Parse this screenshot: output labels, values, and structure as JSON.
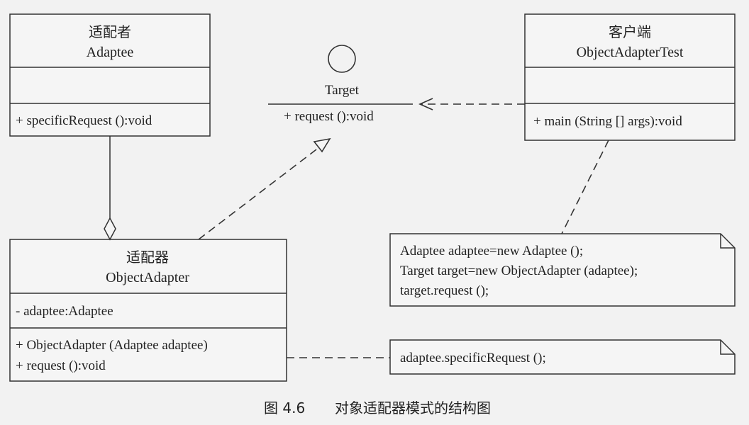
{
  "adaptee": {
    "stereotype": "适配者",
    "name": "Adaptee",
    "operation": "+ specificRequest ():void"
  },
  "target": {
    "name": "Target",
    "operation": "+ request ():void"
  },
  "client": {
    "stereotype": "客户端",
    "name": "ObjectAdapterTest",
    "operation": "+ main (String [] args):void"
  },
  "adapter": {
    "stereotype": "适配器",
    "name": "ObjectAdapter",
    "attribute": "- adaptee:Adaptee",
    "operations": [
      "+ ObjectAdapter (Adaptee adaptee)",
      "+ request ():void"
    ]
  },
  "note_client": {
    "lines": [
      "Adaptee adaptee=new Adaptee ();",
      "Target target=new ObjectAdapter (adaptee);",
      "target.request ();"
    ]
  },
  "note_adapter": {
    "text": "adaptee.specificRequest ();"
  },
  "caption": {
    "number": "图 4.6",
    "title": "对象适配器模式的结构图"
  }
}
